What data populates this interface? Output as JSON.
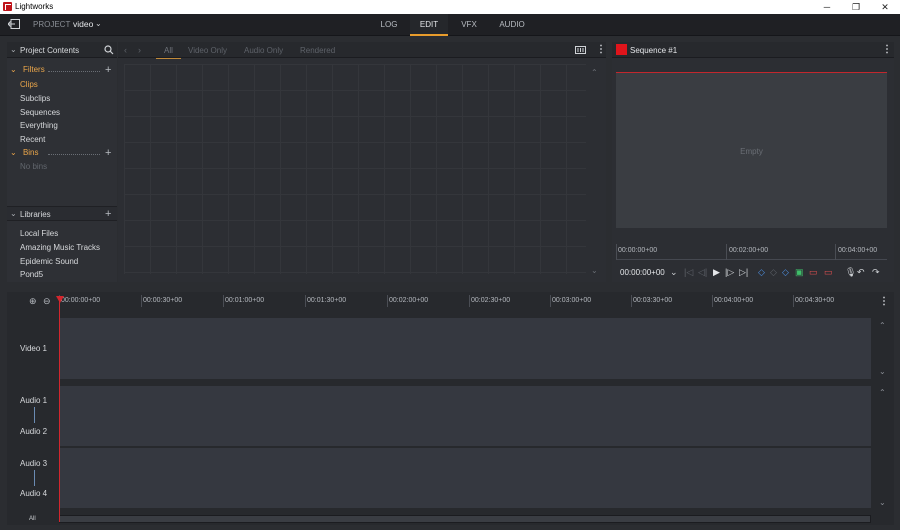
{
  "window": {
    "title": "Lightworks",
    "minimize": "─",
    "maximize": "❐",
    "close": "✕"
  },
  "topbar": {
    "project_label": "PROJECT",
    "project_name": "video",
    "tabs": [
      {
        "label": "LOG"
      },
      {
        "label": "EDIT",
        "active": true
      },
      {
        "label": "VFX"
      },
      {
        "label": "AUDIO"
      }
    ]
  },
  "project_panel": {
    "title": "Project Contents",
    "filters_label": "Filters",
    "filters": [
      "Clips",
      "Subclips",
      "Sequences",
      "Everything",
      "Recent"
    ],
    "selected_filter": "Clips",
    "bins_label": "Bins",
    "bins_empty": "No bins",
    "libraries_label": "Libraries",
    "libraries": [
      "Local Files",
      "Amazing Music Tracks",
      "Epidemic Sound",
      "Pond5"
    ]
  },
  "browser": {
    "tabs": [
      "All",
      "Video Only",
      "Audio Only",
      "Rendered"
    ],
    "active_tab": "All"
  },
  "viewer": {
    "title": "Sequence #1",
    "empty_text": "Empty",
    "ruler_labels": [
      "00:00:00+00",
      "00:02:00+00",
      "00:04:00+00"
    ],
    "timecode": "00:00:00+00"
  },
  "timeline": {
    "ruler_labels": [
      "00:00:00+00",
      "00:00:30+00",
      "00:01:00+00",
      "00:01:30+00",
      "00:02:00+00",
      "00:02:30+00",
      "00:03:00+00",
      "00:03:30+00",
      "00:04:00+00",
      "00:04:30+00"
    ],
    "video_tracks": [
      "Video 1"
    ],
    "audio_tracks": [
      "Audio 1",
      "Audio 2",
      "Audio 3",
      "Audio 4"
    ],
    "all_label": "All"
  },
  "colors": {
    "accent": "#e89c2c",
    "playhead": "#d3262d",
    "record": "#e0141b"
  }
}
